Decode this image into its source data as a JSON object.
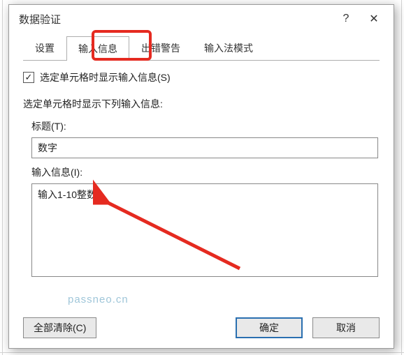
{
  "dialog": {
    "title": "数据验证",
    "help_label": "?",
    "close_label": "✕"
  },
  "tabs": {
    "items": [
      {
        "label": "设置"
      },
      {
        "label": "输入信息"
      },
      {
        "label": "出错警告"
      },
      {
        "label": "输入法模式"
      }
    ],
    "active_index": 1
  },
  "content": {
    "checkbox_label": "选定单元格时显示输入信息(S)",
    "section_heading": "选定单元格时显示下列输入信息:",
    "title_label": "标题(T):",
    "title_value": "数字",
    "message_label": "输入信息(I):",
    "message_value": "输入1-10整数"
  },
  "watermark": "passneo.cn",
  "footer": {
    "clear_label": "全部清除(C)",
    "ok_label": "确定",
    "cancel_label": "取消"
  }
}
